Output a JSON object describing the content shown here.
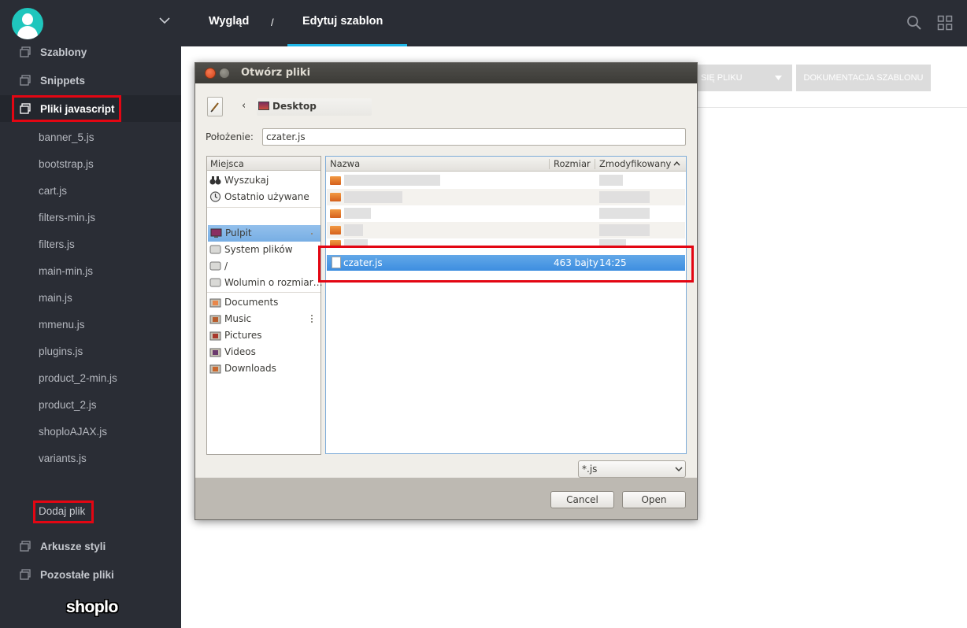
{
  "sidebar": {
    "sections": [
      {
        "label": "Szablony"
      },
      {
        "label": "Snippets"
      },
      {
        "label": "Pliki javascript"
      }
    ],
    "files": [
      "banner_5.js",
      "bootstrap.js",
      "cart.js",
      "filters-min.js",
      "filters.js",
      "main-min.js",
      "main.js",
      "mmenu.js",
      "plugins.js",
      "product_2-min.js",
      "product_2.js",
      "shoploAJAX.js",
      "variants.js"
    ],
    "add_file": "Dodaj plik",
    "bottom_sections": [
      {
        "label": "Arkusze styli"
      },
      {
        "label": "Pozostałe pliki"
      }
    ],
    "logo": "shoplo"
  },
  "topbar": {
    "breadcrumb_1": "Wygląd",
    "separator": "/",
    "breadcrumb_2": "Edytuj szablon"
  },
  "main": {
    "button_partial": "SIĘ PLIKU",
    "button_docs": "DOKUMENTACJA SZABLONU"
  },
  "dialog": {
    "title": "Otwórz pliki",
    "current_folder": "Desktop",
    "location_label": "Położenie:",
    "location_value": "czater.js",
    "places_header": "Miejsca",
    "places": [
      {
        "label": "Wyszukaj",
        "icon": "binoculars-icon"
      },
      {
        "label": "Ostatnio używane",
        "icon": "clock-icon"
      },
      {
        "label": "Pulpit",
        "icon": "desktop-icon"
      },
      {
        "label": "System plików",
        "icon": "drive-icon"
      },
      {
        "label": "/",
        "icon": "drive-icon"
      },
      {
        "label": "Wolumin o rozmiar…",
        "icon": "drive-icon"
      },
      {
        "label": "Documents",
        "icon": "folder-icon"
      },
      {
        "label": "Music",
        "icon": "folder-icon"
      },
      {
        "label": "Pictures",
        "icon": "folder-icon"
      },
      {
        "label": "Videos",
        "icon": "folder-icon"
      },
      {
        "label": "Downloads",
        "icon": "folder-icon"
      }
    ],
    "columns": {
      "name": "Nazwa",
      "size": "Rozmiar",
      "modified": "Zmodyfikowany"
    },
    "selected_file": {
      "name": "czater.js",
      "size": "463 bajty",
      "modified": "14:25"
    },
    "filter": "*.js",
    "cancel": "Cancel",
    "open": "Open"
  },
  "colors": {
    "sidebar": "#2a2d35",
    "accent": "#1fb7e8",
    "highlight": "#e30613",
    "selection": "#3d8ee0"
  }
}
